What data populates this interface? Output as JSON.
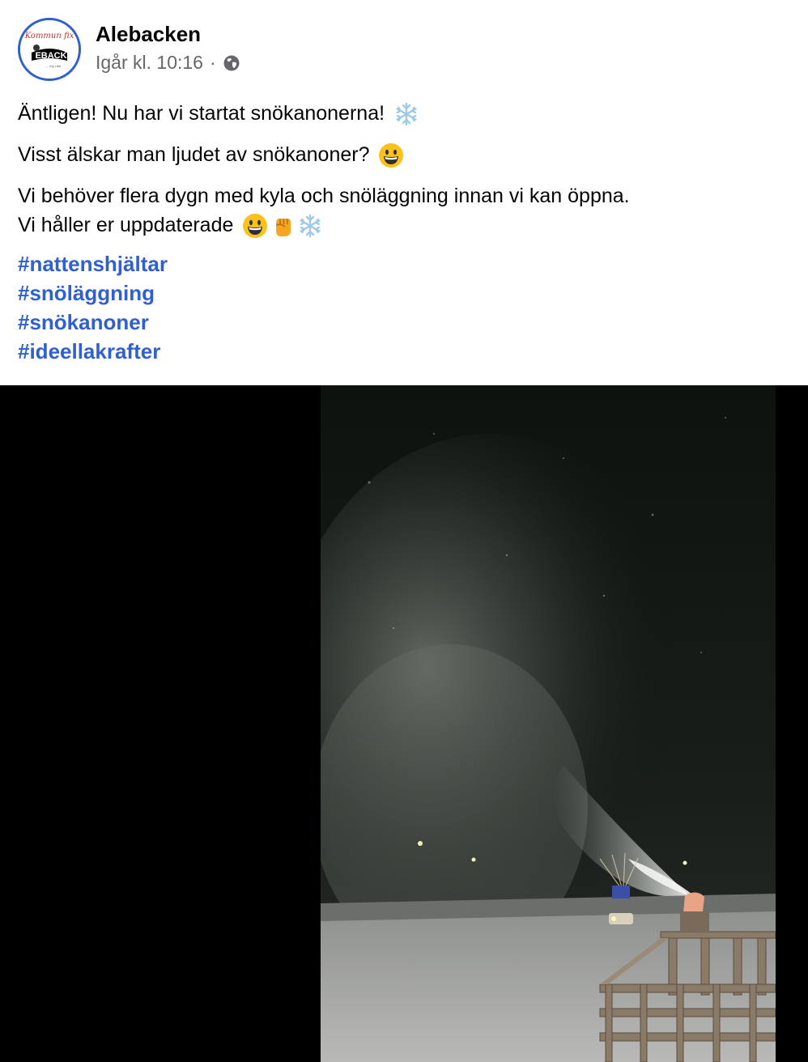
{
  "post": {
    "page_name": "Alebacken",
    "timestamp": "Igår kl. 10:16",
    "separator": "·",
    "privacy_icon": "globe-icon",
    "avatar": {
      "script_text": "Kommun fix",
      "logo_text": "EBACK",
      "small_text": "..... ing i Ale"
    },
    "lines": [
      "Äntligen! Nu har vi startat snökanonerna!",
      "Visst älskar man ljudet av snökanoner?",
      "Vi behöver flera dygn med kyla och snöläggning innan vi kan öppna.",
      "Vi håller er uppdaterade"
    ],
    "emojis": {
      "line1": [
        "snowflake-emoji"
      ],
      "line2": [
        "grinning-face-emoji"
      ],
      "line4": [
        "grinning-face-emoji",
        "raised-fist-emoji",
        "snowflake-emoji"
      ]
    },
    "hashtags": [
      "#nattenshjältar",
      "#snöläggning",
      "#snökanoner",
      "#ideellakrafter"
    ]
  },
  "media": {
    "type": "video",
    "scene": "snow-cannon-at-night"
  },
  "colors": {
    "link": "#2f5fd0",
    "meta": "#65676b",
    "text": "#050505",
    "avatar_ring": "#2f5fd0"
  }
}
